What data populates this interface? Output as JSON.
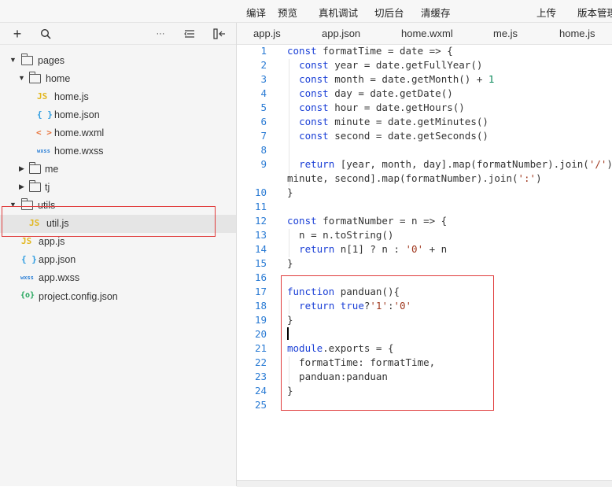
{
  "menubar": {
    "items": [
      "编译",
      "预览",
      "真机调试",
      "切后台",
      "清缓存",
      "上传",
      "版本管理"
    ]
  },
  "sidebar_tools": {
    "add": "+",
    "more": "···"
  },
  "tree": {
    "pages": "pages",
    "home": "home",
    "home_js": "home.js",
    "home_json": "home.json",
    "home_wxml": "home.wxml",
    "home_wxss": "home.wxss",
    "me": "me",
    "tj": "tj",
    "utils": "utils",
    "util_js": "util.js",
    "app_js": "app.js",
    "app_json": "app.json",
    "app_wxss": "app.wxss",
    "project_config": "project.config.json"
  },
  "file_icons": {
    "js": "JS",
    "json": "{ }",
    "wxml": "< >",
    "wxss": "wxss",
    "config": "{o}"
  },
  "tabs": [
    "app.js",
    "app.json",
    "home.wxml",
    "me.js",
    "home.js"
  ],
  "code_lines": [
    {
      "n": "1",
      "text": "const formatTime = date => {"
    },
    {
      "n": "2",
      "text": "  const year = date.getFullYear()"
    },
    {
      "n": "3",
      "text": "  const month = date.getMonth() + 1"
    },
    {
      "n": "4",
      "text": "  const day = date.getDate()"
    },
    {
      "n": "5",
      "text": "  const hour = date.getHours()"
    },
    {
      "n": "6",
      "text": "  const minute = date.getMinutes()"
    },
    {
      "n": "7",
      "text": "  const second = date.getSeconds()"
    },
    {
      "n": "8",
      "text": ""
    },
    {
      "n": "9",
      "text": "  return [year, month, day].map(formatNumber).join('/')"
    },
    {
      "n": "",
      "text": "minute, second].map(formatNumber).join(':')"
    },
    {
      "n": "10",
      "text": "}"
    },
    {
      "n": "11",
      "text": ""
    },
    {
      "n": "12",
      "text": "const formatNumber = n => {"
    },
    {
      "n": "13",
      "text": "  n = n.toString()"
    },
    {
      "n": "14",
      "text": "  return n[1] ? n : '0' + n"
    },
    {
      "n": "15",
      "text": "}"
    },
    {
      "n": "16",
      "text": ""
    },
    {
      "n": "17",
      "text": "function panduan(){"
    },
    {
      "n": "18",
      "text": "  return true?'1':'0'"
    },
    {
      "n": "19",
      "text": "}"
    },
    {
      "n": "20",
      "text": ""
    },
    {
      "n": "21",
      "text": "module.exports = {"
    },
    {
      "n": "22",
      "text": "  formatTime: formatTime,"
    },
    {
      "n": "23",
      "text": "  panduan:panduan"
    },
    {
      "n": "24",
      "text": "}"
    },
    {
      "n": "25",
      "text": ""
    }
  ],
  "colors": {
    "keyword": "#1a3fd6",
    "line_number": "#2a7bd4",
    "highlight_box": "#e03c3c"
  }
}
